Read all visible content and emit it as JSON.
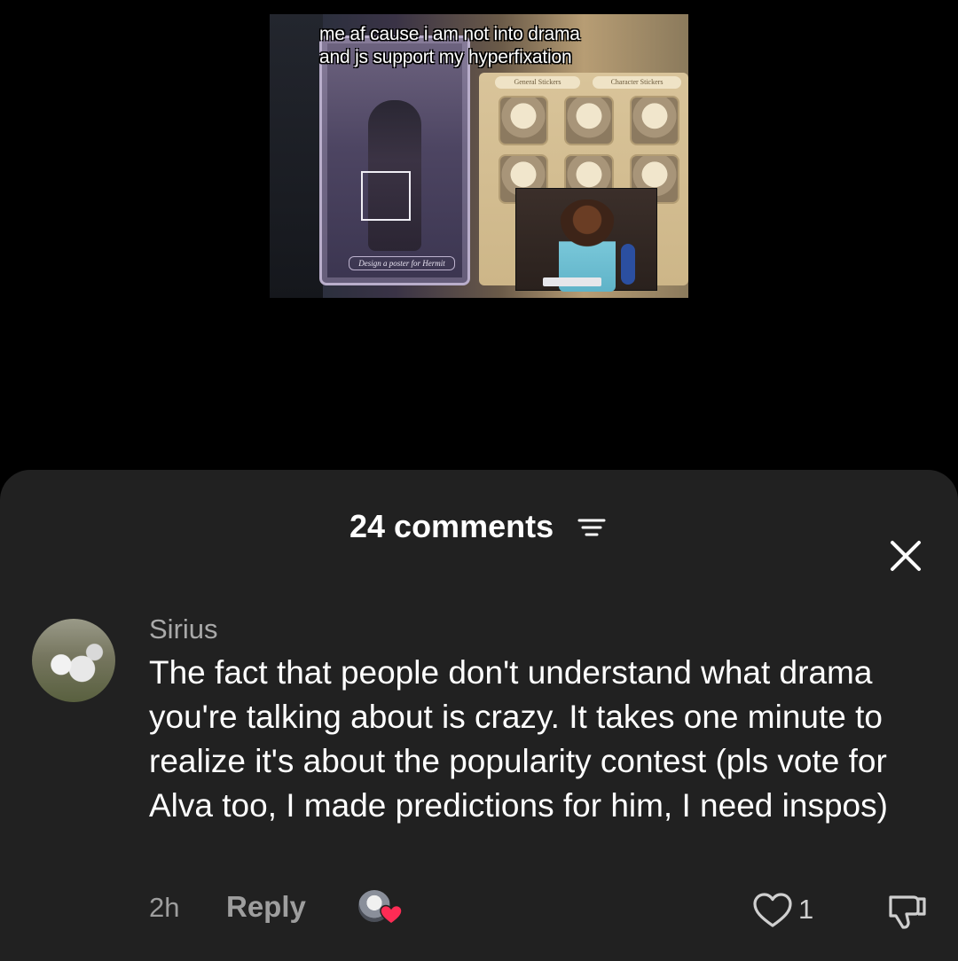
{
  "video": {
    "caption_line1": "me af cause i am not into drama",
    "caption_line2": "and js support my hyperfixation",
    "tab_general": "General Stickers",
    "tab_character": "Character Stickers",
    "poster_caption": "Design a poster for Hermit"
  },
  "sheet": {
    "title": "24 comments",
    "sort_icon": "sort-lines-icon",
    "close_icon": "close-x-icon"
  },
  "comment": {
    "username": "Sirius",
    "text": "The fact that people don't understand what drama you're talking about is crazy. It takes one minute to realize it's about the popularity contest (pls vote for Alva too, I made predictions for him, I need inspos)",
    "time": "2h",
    "reply_label": "Reply",
    "like_count": "1",
    "liked_by_creator": true
  },
  "colors": {
    "sheet_bg": "#212121",
    "page_bg": "#000000",
    "heart_red": "#fe2c55",
    "muted_text": "#9e9e9e"
  }
}
